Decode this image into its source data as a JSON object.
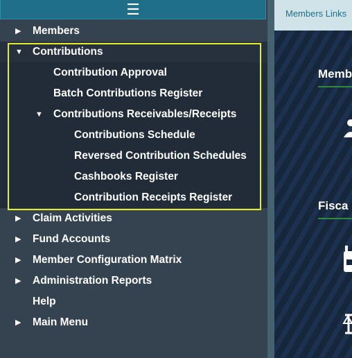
{
  "sidebar": {
    "items": [
      {
        "label": "Members",
        "arrow": "▶"
      },
      {
        "label": "Contributions",
        "arrow": "▼"
      },
      {
        "label": "Contribution Approval"
      },
      {
        "label": "Batch Contributions Register"
      },
      {
        "label": "Contributions Receivables/Receipts",
        "arrow": "▼"
      },
      {
        "label": "Contributions Schedule"
      },
      {
        "label": "Reversed Contribution Schedules"
      },
      {
        "label": "Cashbooks Register"
      },
      {
        "label": "Contribution Receipts Register"
      },
      {
        "label": "Claim Activities",
        "arrow": "▶"
      },
      {
        "label": "Fund Accounts",
        "arrow": "▶"
      },
      {
        "label": "Member Configuration Matrix",
        "arrow": "▶"
      },
      {
        "label": "Administration Reports",
        "arrow": "▶"
      },
      {
        "label": "Help"
      },
      {
        "label": "Main Menu",
        "arrow": "▶"
      }
    ]
  },
  "header": {
    "menu_icon": "☰"
  },
  "main": {
    "tab_label": "Members Links",
    "sections": [
      {
        "title": "Memb"
      },
      {
        "title": "Fisca"
      }
    ]
  },
  "colors": {
    "sidebar_bg": "#34434f",
    "submenu_bg": "#212c38",
    "highlight_border": "#e8ee2a",
    "topbar_bg": "#1f6f8b"
  }
}
